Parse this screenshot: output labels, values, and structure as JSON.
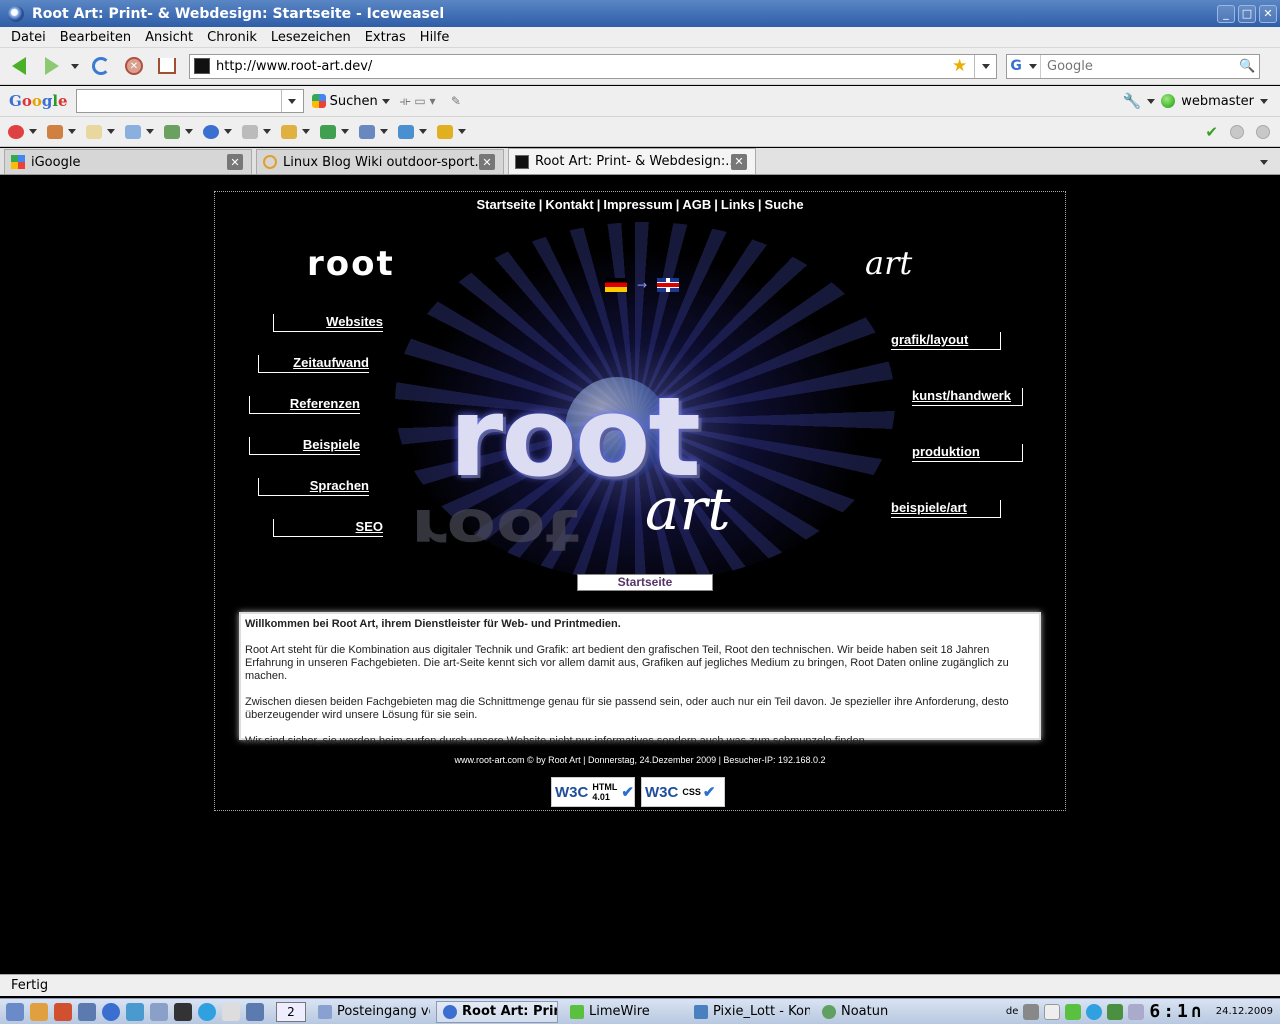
{
  "window": {
    "title": "Root Art: Print- & Webdesign: Startseite - Iceweasel"
  },
  "menu": [
    "Datei",
    "Bearbeiten",
    "Ansicht",
    "Chronik",
    "Lesezeichen",
    "Extras",
    "Hilfe"
  ],
  "nav": {
    "url": "http://www.root-art.dev/",
    "search_placeholder": "Google"
  },
  "google_toolbar": {
    "logo": "Google",
    "search_label": "Suchen",
    "user": "webmaster"
  },
  "tabs": [
    {
      "title": "iGoogle"
    },
    {
      "title": "Linux Blog Wiki outdoor-sport..."
    },
    {
      "title": "Root Art: Print- & Webdesign:..."
    }
  ],
  "site": {
    "top_nav": [
      "Startseite",
      "Kontakt",
      "Impressum",
      "AGB",
      "Links",
      "Suche"
    ],
    "logo_left": "root",
    "logo_right": "art",
    "hero_word": "root",
    "hero_script": "art",
    "left_nav": [
      "Websites",
      "Zeitaufwand",
      "Referenzen",
      "Beispiele",
      "Sprachen",
      "SEO"
    ],
    "right_nav": [
      "grafik/layout",
      "kunst/handwerk",
      "produktion",
      "beispiele/art"
    ],
    "current_page": "Startseite",
    "welcome": {
      "heading": "Willkommen bei Root Art, ihrem Dienstleister für Web- und Printmedien.",
      "p1": "Root Art steht für die Kombination aus digitaler Technik und Grafik: art bedient den grafischen Teil, Root den technischen. Wir beide haben seit 18 Jahren Erfahrung in unseren Fachgebieten. Die art-Seite kennt sich vor allem damit aus, Grafiken auf jegliches Medium zu bringen, Root Daten online zugänglich zu machen.",
      "p2": "Zwischen diesen beiden Fachgebieten mag die Schnittmenge genau für sie passend sein, oder auch nur ein Teil davon. Je spezieller ihre Anforderung, desto überzeugender wird unsere Lösung für sie sein.",
      "p3": "Wir sind sicher, sie werden beim surfen durch unsere Website nicht nur informatives sondern auch was zum schmunzeln finden."
    },
    "footer": "www.root-art.com © by  Root Art | Donnerstag, 24.Dezember 2009 | Besucher-IP: 192.168.0.2",
    "badges": [
      {
        "logo": "W3C",
        "label": "HTML 4.01"
      },
      {
        "logo": "W3C",
        "label": "CSS"
      }
    ]
  },
  "status": "Fertig",
  "taskbar": {
    "pager": "2",
    "tasks": [
      {
        "label": "Posteingang von"
      },
      {
        "label": "Root Art: Print"
      },
      {
        "label": "LimeWire"
      },
      {
        "label": "Pixie_Lott - Kon"
      },
      {
        "label": "Noatun"
      }
    ],
    "tray_lang": "de",
    "clock_lcd": "6:1∩",
    "date": "24.12.2009"
  },
  "colors": {
    "title_bar": "#2f5ea8",
    "page_bg": "#000000",
    "accent_blue": "#3a6fd0"
  }
}
